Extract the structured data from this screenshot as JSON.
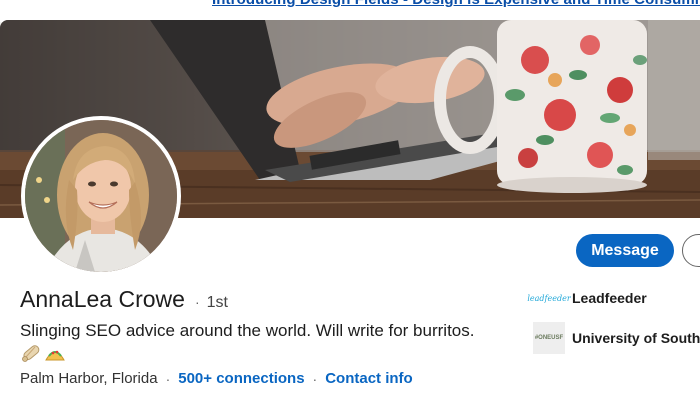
{
  "top_link": {
    "text": "Introducing Design Fields - Design is Expensive and Time Consuming"
  },
  "profile": {
    "name": "AnnaLea Crowe",
    "degree": "1st",
    "headline": "Slinging SEO advice around the world. Will write for burritos.",
    "emojis": [
      "burrito-emoji",
      "taco-emoji"
    ],
    "location": "Palm Harbor, Florida",
    "connections": "500+ connections",
    "contact_info": "Contact info"
  },
  "actions": {
    "message_label": "Message"
  },
  "organizations": [
    {
      "name": "Leadfeeder",
      "logo_text": "leadfeeder"
    },
    {
      "name": "University of South Florida",
      "logo_text": "#ONEUSF"
    }
  ],
  "colors": {
    "brand_blue": "#0a66c2",
    "text_primary": "#1d1d1d",
    "page_bg": "#f3f2ef"
  }
}
